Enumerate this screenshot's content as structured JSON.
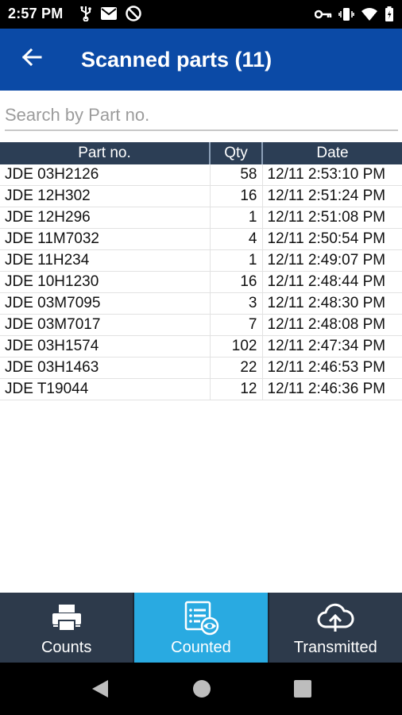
{
  "status": {
    "time": "2:57 PM",
    "left_icons": [
      "usb-icon",
      "mail-icon",
      "do-not-disturb-icon"
    ],
    "right_icons": [
      "vpn-key-icon",
      "vibrate-icon",
      "wifi-icon",
      "battery-icon"
    ]
  },
  "appbar": {
    "back_icon": "arrow-left-icon",
    "title": "Scanned parts (11)"
  },
  "search": {
    "placeholder": "Search by Part no.",
    "value": ""
  },
  "table": {
    "columns": [
      "Part no.",
      "Qty",
      "Date"
    ],
    "rows": [
      {
        "part": "JDE 03H2126",
        "qty": "58",
        "date": "12/11 2:53:10 PM"
      },
      {
        "part": "JDE 12H302",
        "qty": "16",
        "date": "12/11 2:51:24 PM"
      },
      {
        "part": "JDE 12H296",
        "qty": "1",
        "date": "12/11 2:51:08 PM"
      },
      {
        "part": "JDE 11M7032",
        "qty": "4",
        "date": "12/11 2:50:54 PM"
      },
      {
        "part": "JDE 11H234",
        "qty": "1",
        "date": "12/11 2:49:07 PM"
      },
      {
        "part": "JDE 10H1230",
        "qty": "16",
        "date": "12/11 2:48:44 PM"
      },
      {
        "part": "JDE 03M7095",
        "qty": "3",
        "date": "12/11 2:48:30 PM"
      },
      {
        "part": "JDE 03M7017",
        "qty": "7",
        "date": "12/11 2:48:08 PM"
      },
      {
        "part": "JDE 03H1574",
        "qty": "102",
        "date": "12/11 2:47:34 PM"
      },
      {
        "part": "JDE 03H1463",
        "qty": "22",
        "date": "12/11 2:46:53 PM"
      },
      {
        "part": "JDE T19044",
        "qty": "12",
        "date": "12/11 2:46:36 PM"
      }
    ]
  },
  "bottom_nav": {
    "items": [
      {
        "label": "Counts",
        "icon": "printer-icon",
        "active": false
      },
      {
        "label": "Counted",
        "icon": "counted-list-icon",
        "active": true
      },
      {
        "label": "Transmitted",
        "icon": "cloud-upload-icon",
        "active": false
      }
    ]
  },
  "colors": {
    "appbar": "#0b4aa6",
    "table_header": "#2c3e55",
    "nav_bg": "#2d3a4b",
    "nav_active": "#29aae1"
  }
}
